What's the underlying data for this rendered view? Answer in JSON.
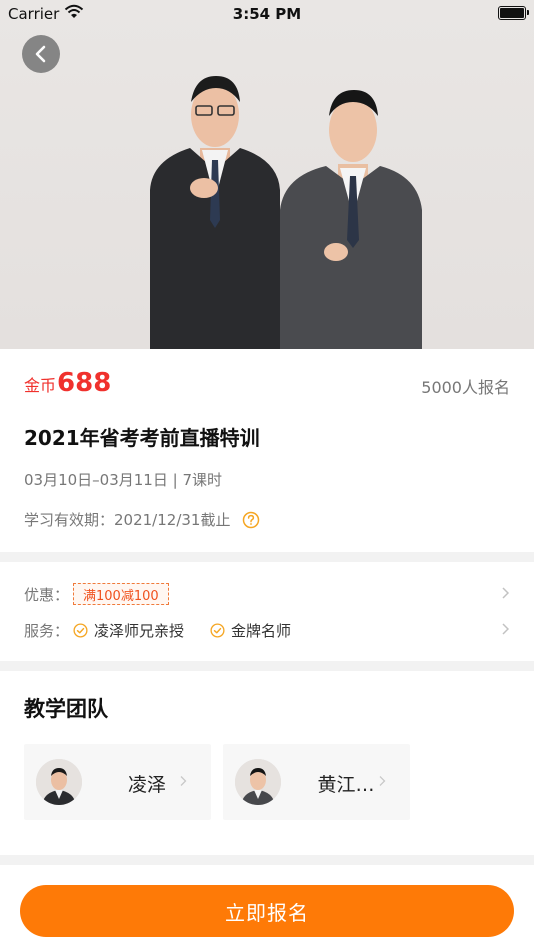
{
  "status_bar": {
    "carrier": "Carrier",
    "time": "3:54 PM"
  },
  "icons": {
    "back": "chevron-left-icon",
    "help": "question-circle-icon",
    "check": "check-circle-icon",
    "wifi": "wifi-icon",
    "battery": "battery-icon"
  },
  "colors": {
    "accent": "#fe7a07",
    "price": "#f0312d",
    "help_icon": "#f5a623"
  },
  "course": {
    "price_unit": "金币",
    "price": "688",
    "enrolled": "5000人报名",
    "title": "2021年省考考前直播特训",
    "meta": "03月10日–03月11日 | 7课时",
    "validity": "学习有效期：2021/12/31截止"
  },
  "offers": {
    "promo_label": "优惠：",
    "promo_tag": "满100减100",
    "service_label": "服务：",
    "services": [
      "凌泽师兄亲授",
      "金牌名师"
    ]
  },
  "team": {
    "title": "教学团队",
    "teachers": [
      {
        "name": "凌泽"
      },
      {
        "name": "黄江…"
      }
    ]
  },
  "cta": {
    "label": "立即报名"
  }
}
